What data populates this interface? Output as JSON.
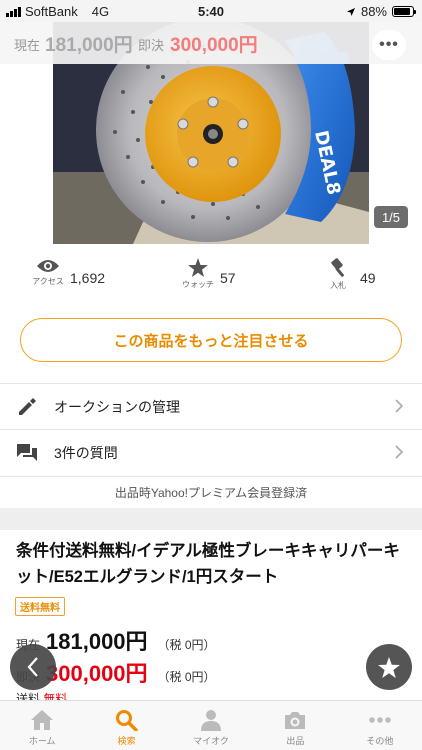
{
  "status_bar": {
    "carrier": "SoftBank",
    "network": "4G",
    "time": "5:40",
    "battery": "88%",
    "battery_level": 0.88
  },
  "header": {
    "current_label": "現在",
    "current_price": "181,000円",
    "buyout_label": "即決",
    "buyout_price": "300,000円",
    "more_icon": "more-horizontal-icon"
  },
  "image": {
    "pager": "1/5",
    "caliper_brand": "DEAL8"
  },
  "stats": [
    {
      "icon": "eye-icon",
      "caption": "アクセス",
      "value": "1,692"
    },
    {
      "icon": "star-icon",
      "caption": "ウォッチ",
      "value": "57"
    },
    {
      "icon": "gavel-icon",
      "caption": "入札",
      "value": "49"
    }
  ],
  "cta": {
    "label": "この商品をもっと注目させる"
  },
  "menu": [
    {
      "icon": "pencil-icon",
      "label": "オークションの管理"
    },
    {
      "icon": "chat-icon",
      "label": "3件の質問"
    }
  ],
  "premium_note": "出品時Yahoo!プレミアム会員登録済",
  "item": {
    "title": "条件付送料無料/イデアル極性ブレーキキャリパーキット/E52エルグランド/1円スタート",
    "badge": "送料無料",
    "current_label": "現在",
    "current_price": "181,000円",
    "current_tax": "（税 0円）",
    "buyout_label": "即決",
    "buyout_price": "300,000円",
    "buyout_tax": "（税 0円）",
    "shipping_label": "送料",
    "shipping_value": "無料"
  },
  "tabs": [
    {
      "icon": "home-icon",
      "label": "ホーム",
      "active": false
    },
    {
      "icon": "search-icon",
      "label": "検索",
      "active": true
    },
    {
      "icon": "user-icon",
      "label": "マイオク",
      "active": false
    },
    {
      "icon": "camera-icon",
      "label": "出品",
      "active": false
    },
    {
      "icon": "more-horizontal-icon",
      "label": "その他",
      "active": false
    }
  ],
  "colors": {
    "accent": "#f08a00",
    "price_red": "#e60012",
    "caliper_blue": "#1e6fd6",
    "disc_hat_orange": "#f0a31a"
  }
}
